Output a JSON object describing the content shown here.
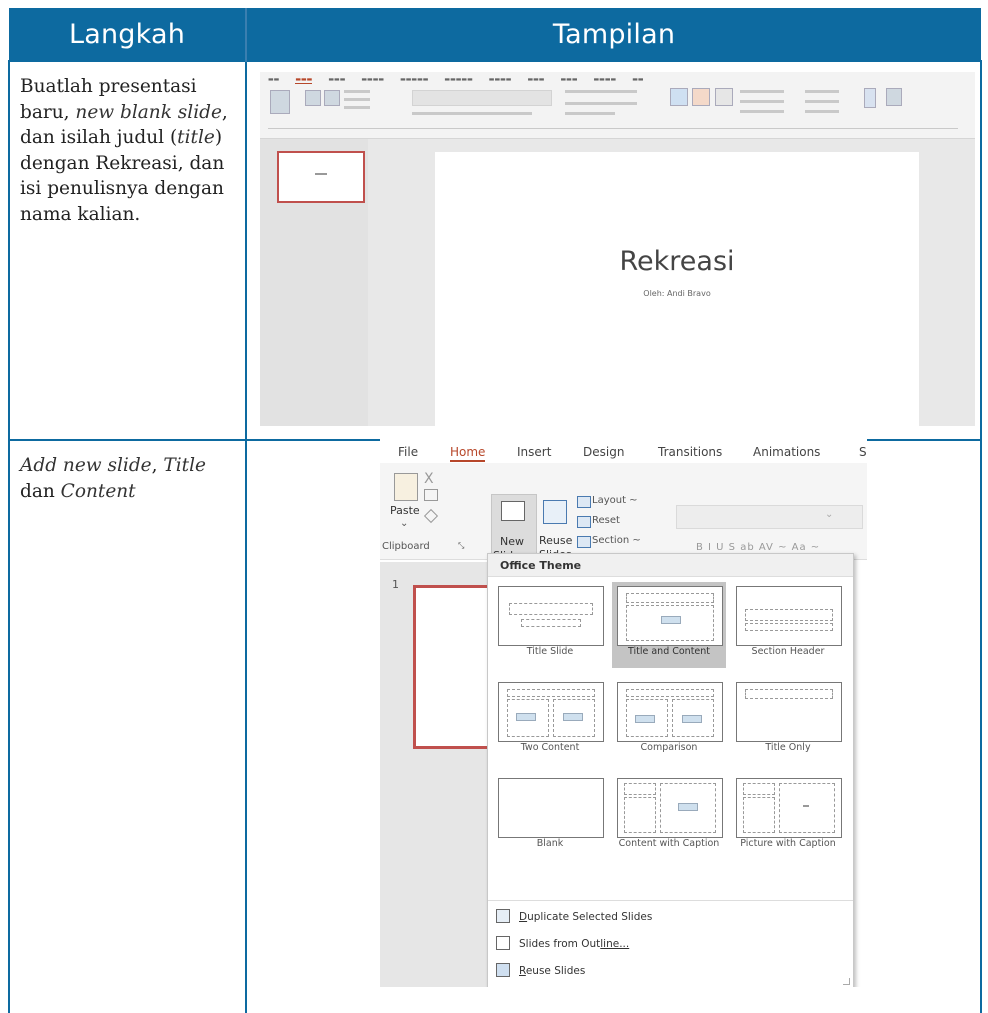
{
  "table": {
    "header_steps": "Langkah",
    "header_view": "Tampilan"
  },
  "row1": {
    "step_parts": [
      "Buatlah presentasi baru, ",
      "new blank slide",
      ", dan isilah judul (",
      "title",
      ") dengan Rekreasi, dan isi penulisnya dengan nama kalian."
    ],
    "screenshot": {
      "slide_title": "Rekreasi",
      "slide_subtitle": "Oleh: Andi Bravo"
    }
  },
  "row2": {
    "step_parts": [
      "Add new slide",
      ", ",
      "Title",
      " dan ",
      "Content"
    ],
    "screenshot": {
      "menu": [
        "File",
        "Home",
        "Insert",
        "Design",
        "Transitions",
        "Animations",
        "S"
      ],
      "active_menu": "Home",
      "ribbon": {
        "paste": "Paste",
        "new_slide": [
          "New",
          "Slide ~"
        ],
        "reuse_slides": [
          "Reuse",
          "Slides"
        ],
        "layout": "Layout ~",
        "reset": "Reset",
        "section": "Section ~",
        "clipboard_group": "Clipboard",
        "font_tools": "B  I  U  S  ab  AV ~  Aa ~"
      },
      "slide_number": "1",
      "dropdown": {
        "header": "Office Theme",
        "layouts": [
          "Title Slide",
          "Title and Content",
          "Section Header",
          "Two Content",
          "Comparison",
          "Title Only",
          "Blank",
          "Content with Caption",
          "Picture with Caption"
        ],
        "selected": "Title and Content",
        "commands": [
          {
            "lead": "D",
            "rest": "uplicate Selected Slides"
          },
          {
            "lead": "Slides from Out",
            "rest": "line..."
          },
          {
            "lead": "R",
            "rest": "euse Slides"
          }
        ]
      }
    }
  }
}
